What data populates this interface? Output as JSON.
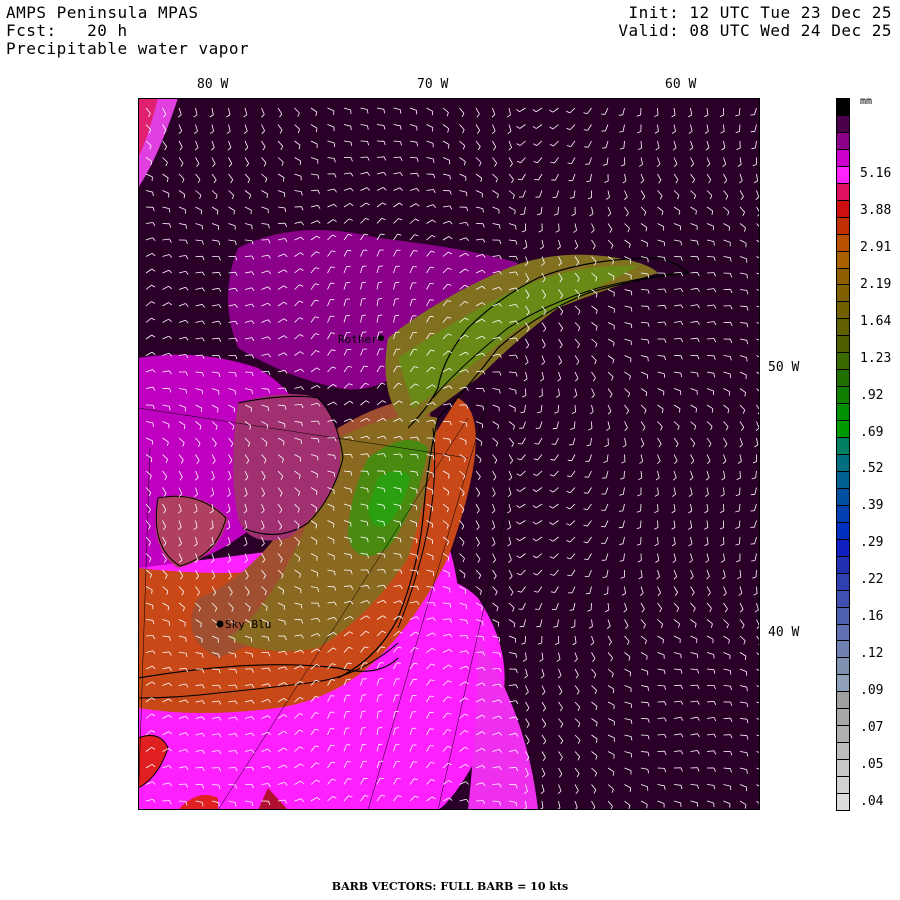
{
  "header": {
    "title": "AMPS Peninsula MPAS",
    "forecast": "Fcst:   20 h",
    "field": "Precipitable water vapor",
    "init": "Init: 12 UTC Tue 23 Dec 25",
    "valid": "Valid: 08 UTC Wed 24 Dec 25"
  },
  "longitude_labels": {
    "top": [
      "80 W",
      "70 W",
      "60 W"
    ],
    "right": [
      "50 W",
      "40 W"
    ]
  },
  "stations": [
    {
      "name": "Rother"
    },
    {
      "name": "Sky Blu"
    }
  ],
  "colorbar": {
    "units": "mm",
    "colors": [
      "#000000",
      "#4a004a",
      "#8a008a",
      "#cc00cc",
      "#ff22ff",
      "#e01060",
      "#cc1010",
      "#c03000",
      "#b85000",
      "#a86000",
      "#906000",
      "#806000",
      "#706000",
      "#606000",
      "#506000",
      "#3a6a00",
      "#207000",
      "#108000",
      "#009000",
      "#009a00",
      "#008060",
      "#007080",
      "#006090",
      "#0050a0",
      "#0040b0",
      "#0030c0",
      "#1020c0",
      "#2030b0",
      "#3040b0",
      "#4050b0",
      "#5060b0",
      "#6070b0",
      "#7080b0",
      "#8090b0",
      "#90a0b8",
      "#a0a0a0",
      "#a8a8a8",
      "#b0b0b0",
      "#bcbcbc",
      "#c8c8c8",
      "#d2d2d2",
      "#dcdcdc"
    ],
    "labels": [
      "5.16",
      "3.88",
      "2.91",
      "2.19",
      "1.64",
      "1.23",
      ".92",
      ".69",
      ".52",
      ".39",
      ".29",
      ".22",
      ".16",
      ".12",
      ".09",
      ".07",
      ".05",
      ".04"
    ]
  },
  "footer": "BARB VECTORS:  FULL BARB = 10 kts"
}
